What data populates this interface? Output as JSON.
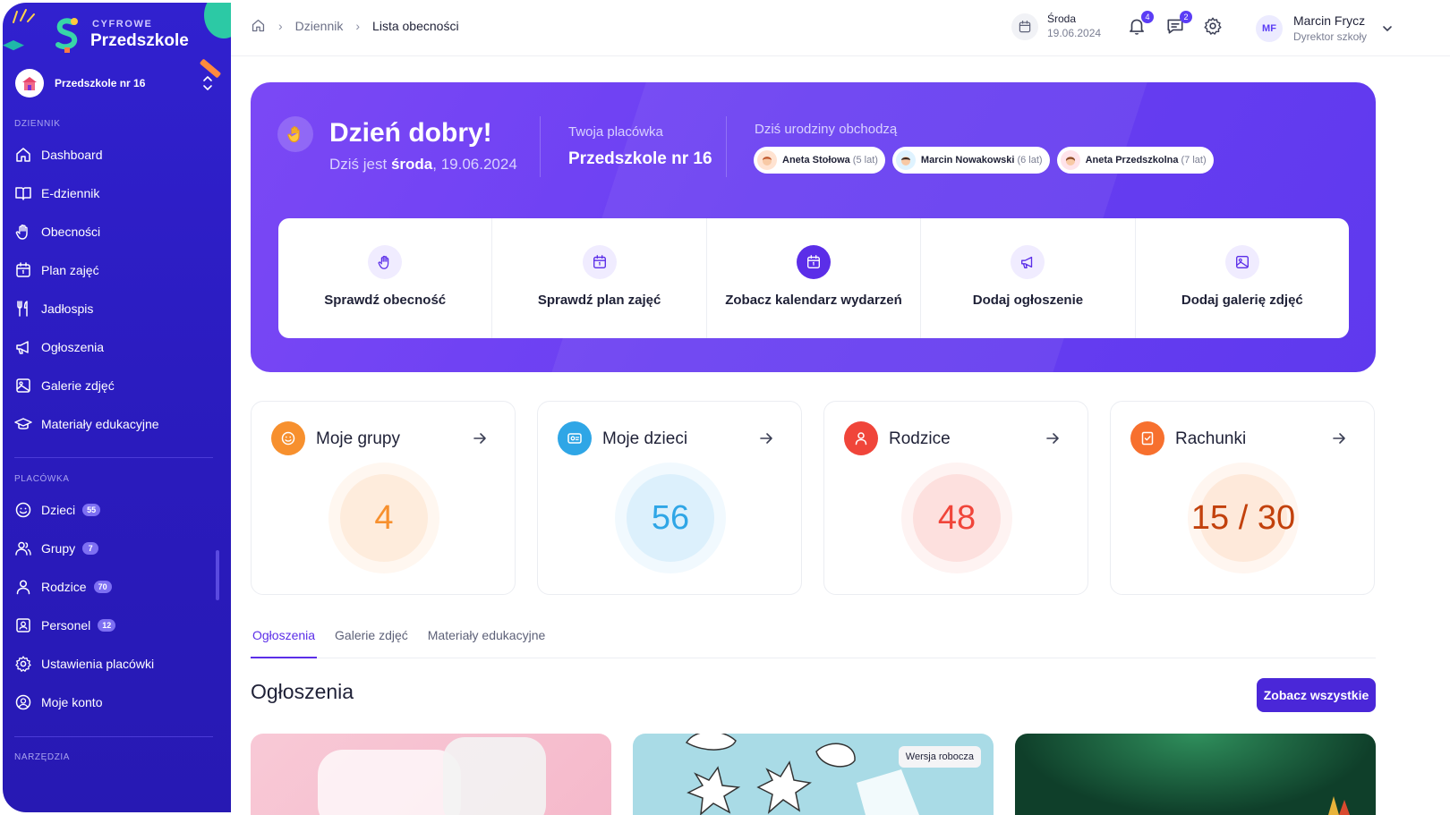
{
  "brand": {
    "line1": "CYFROWE",
    "line2": "Przedszkole"
  },
  "school_switch": {
    "name": "Przedszkole nr 16"
  },
  "sidebar": {
    "section_dziennik": "DZIENNIK",
    "items_dziennik": [
      {
        "label": "Dashboard",
        "icon": "home-icon"
      },
      {
        "label": "E-dziennik",
        "icon": "book-icon"
      },
      {
        "label": "Obecności",
        "icon": "hand-icon"
      },
      {
        "label": "Plan zajęć",
        "icon": "calendar-icon"
      },
      {
        "label": "Jadłospis",
        "icon": "cutlery-icon"
      },
      {
        "label": "Ogłoszenia",
        "icon": "megaphone-icon"
      },
      {
        "label": "Galerie zdjęć",
        "icon": "image-icon"
      },
      {
        "label": "Materiały edukacyjne",
        "icon": "graduation-icon"
      }
    ],
    "section_placowka": "PLACÓWKA",
    "items_placowka": [
      {
        "label": "Dzieci",
        "badge": "55",
        "icon": "smile-icon"
      },
      {
        "label": "Grupy",
        "badge": "7",
        "icon": "users-icon"
      },
      {
        "label": "Rodzice",
        "badge": "70",
        "icon": "user-icon"
      },
      {
        "label": "Personel",
        "badge": "12",
        "icon": "id-card-icon"
      },
      {
        "label": "Ustawienia placówki",
        "icon": "gear-icon"
      },
      {
        "label": "Moje konto",
        "icon": "account-icon"
      }
    ],
    "section_narzedzia": "NARZĘDZIA"
  },
  "breadcrumb": {
    "items": [
      "Dziennik",
      "Lista obecności"
    ]
  },
  "topbar": {
    "day": "Środa",
    "date": "19.06.2024",
    "notifications_count": "4",
    "messages_count": "2",
    "user_initials": "MF",
    "user_name": "Marcin Frycz",
    "user_role": "Dyrektor szkoły"
  },
  "hero": {
    "greeting": "Dzień dobry!",
    "today_prefix": "Dziś jest",
    "today_day": "środa",
    "today_date": ", 19.06.2024",
    "place_label": "Twoja placówka",
    "place_name": "Przedszkole nr 16",
    "birthdays_label": "Dziś urodziny obchodzą",
    "birthdays": [
      {
        "name": "Aneta Stołowa",
        "age": "(5 lat)"
      },
      {
        "name": "Marcin Nowakowski",
        "age": "(6 lat)"
      },
      {
        "name": "Aneta Przedszkolna",
        "age": "(7 lat)"
      }
    ]
  },
  "actions": [
    {
      "label": "Sprawdź obecność",
      "icon": "hand-icon"
    },
    {
      "label": "Sprawdź plan zajęć",
      "icon": "calendar-icon"
    },
    {
      "label": "Zobacz kalendarz wydarzeń",
      "icon": "calendar-icon"
    },
    {
      "label": "Dodaj ogłoszenie",
      "icon": "megaphone-icon"
    },
    {
      "label": "Dodaj galerię zdjęć",
      "icon": "image-icon"
    }
  ],
  "cards": [
    {
      "title": "Moje grupy",
      "value": "4",
      "color": "#f7902e"
    },
    {
      "title": "Moje dzieci",
      "value": "56",
      "color": "#2fa6e6"
    },
    {
      "title": "Rodzice",
      "value": "48",
      "color": "#f0453a"
    },
    {
      "title": "Rachunki",
      "value": "15 / 30",
      "color": "#f7702e"
    }
  ],
  "tabs": [
    "Ogłoszenia",
    "Galerie zdjęć",
    "Materiały edukacyjne"
  ],
  "announcements": {
    "title": "Ogłoszenia",
    "see_all": "Zobacz wszystkie",
    "draft_label": "Wersja robocza"
  }
}
